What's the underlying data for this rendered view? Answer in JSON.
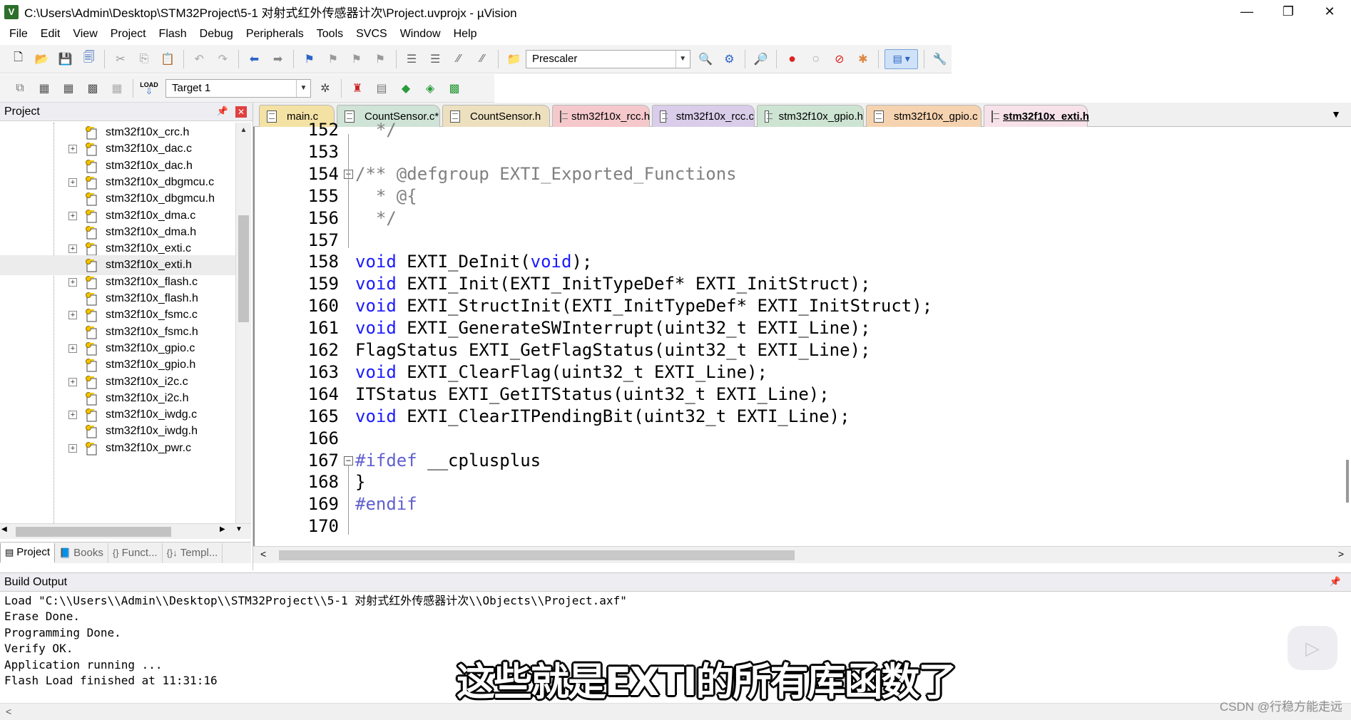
{
  "window": {
    "title": "C:\\Users\\Admin\\Desktop\\STM32Project\\5-1 对射式红外传感器计次\\Project.uvprojx - µVision",
    "minimize": "—",
    "restore": "❐",
    "close": "✕"
  },
  "menu": [
    "File",
    "Edit",
    "View",
    "Project",
    "Flash",
    "Debug",
    "Peripherals",
    "Tools",
    "SVCS",
    "Window",
    "Help"
  ],
  "toolbar1": {
    "find_combo_value": "Prescaler"
  },
  "toolbar2": {
    "target_combo_value": "Target 1",
    "load_label": "LOAD"
  },
  "project_panel": {
    "title": "Project",
    "files": [
      {
        "name": "stm32f10x_crc.h",
        "expandable": false,
        "selected": false
      },
      {
        "name": "stm32f10x_dac.c",
        "expandable": true,
        "selected": false
      },
      {
        "name": "stm32f10x_dac.h",
        "expandable": false,
        "selected": false
      },
      {
        "name": "stm32f10x_dbgmcu.c",
        "expandable": true,
        "selected": false
      },
      {
        "name": "stm32f10x_dbgmcu.h",
        "expandable": false,
        "selected": false
      },
      {
        "name": "stm32f10x_dma.c",
        "expandable": true,
        "selected": false
      },
      {
        "name": "stm32f10x_dma.h",
        "expandable": false,
        "selected": false
      },
      {
        "name": "stm32f10x_exti.c",
        "expandable": true,
        "selected": false
      },
      {
        "name": "stm32f10x_exti.h",
        "expandable": false,
        "selected": true
      },
      {
        "name": "stm32f10x_flash.c",
        "expandable": true,
        "selected": false
      },
      {
        "name": "stm32f10x_flash.h",
        "expandable": false,
        "selected": false
      },
      {
        "name": "stm32f10x_fsmc.c",
        "expandable": true,
        "selected": false
      },
      {
        "name": "stm32f10x_fsmc.h",
        "expandable": false,
        "selected": false
      },
      {
        "name": "stm32f10x_gpio.c",
        "expandable": true,
        "selected": false
      },
      {
        "name": "stm32f10x_gpio.h",
        "expandable": false,
        "selected": false
      },
      {
        "name": "stm32f10x_i2c.c",
        "expandable": true,
        "selected": false
      },
      {
        "name": "stm32f10x_i2c.h",
        "expandable": false,
        "selected": false
      },
      {
        "name": "stm32f10x_iwdg.c",
        "expandable": true,
        "selected": false
      },
      {
        "name": "stm32f10x_iwdg.h",
        "expandable": false,
        "selected": false
      },
      {
        "name": "stm32f10x_pwr.c",
        "expandable": true,
        "selected": false
      }
    ],
    "tabs": [
      {
        "label": "Project",
        "active": true
      },
      {
        "label": "Books",
        "active": false
      },
      {
        "label": "Funct...",
        "active": false
      },
      {
        "label": "Templ...",
        "active": false
      }
    ]
  },
  "editor_tabs": [
    {
      "label": "main.c",
      "color": "#f4e2a4",
      "active": false
    },
    {
      "label": "CountSensor.c*",
      "color": "#cfe3d6",
      "active": false
    },
    {
      "label": "CountSensor.h",
      "color": "#ede0bf",
      "active": false
    },
    {
      "label": "stm32f10x_rcc.h",
      "color": "#f5c8cc",
      "active": false
    },
    {
      "label": "stm32f10x_rcc.c",
      "color": "#d9cdea",
      "active": false
    },
    {
      "label": "stm32f10x_gpio.h",
      "color": "#cde4d3",
      "active": false
    },
    {
      "label": "stm32f10x_gpio.c",
      "color": "#f6d3b0",
      "active": false
    },
    {
      "label": "stm32f10x_exti.h",
      "color": "#f7e2ea",
      "active": true
    }
  ],
  "code": [
    {
      "n": "152",
      "parts": [
        {
          "t": "  */",
          "c": "cm"
        }
      ]
    },
    {
      "n": "153",
      "parts": []
    },
    {
      "n": "154",
      "parts": [
        {
          "t": "/** @defgroup EXTI_Exported_Functions",
          "c": "cm"
        }
      ],
      "fold": "box"
    },
    {
      "n": "155",
      "parts": [
        {
          "t": "  * @{",
          "c": "cm"
        }
      ]
    },
    {
      "n": "156",
      "parts": [
        {
          "t": "  */",
          "c": "cm"
        }
      ]
    },
    {
      "n": "157",
      "parts": []
    },
    {
      "n": "158",
      "parts": [
        {
          "t": "void",
          "c": "kw"
        },
        {
          "t": " EXTI_DeInit(",
          "c": ""
        },
        {
          "t": "void",
          "c": "kw"
        },
        {
          "t": ");",
          "c": ""
        }
      ]
    },
    {
      "n": "159",
      "parts": [
        {
          "t": "void",
          "c": "kw"
        },
        {
          "t": " EXTI_Init(EXTI_InitTypeDef* EXTI_InitStruct);",
          "c": ""
        }
      ]
    },
    {
      "n": "160",
      "parts": [
        {
          "t": "void",
          "c": "kw"
        },
        {
          "t": " EXTI_StructInit(EXTI_InitTypeDef* EXTI_InitStruct);",
          "c": ""
        }
      ]
    },
    {
      "n": "161",
      "parts": [
        {
          "t": "void",
          "c": "kw"
        },
        {
          "t": " EXTI_GenerateSWInterrupt(uint32_t EXTI_Line);",
          "c": ""
        }
      ]
    },
    {
      "n": "162",
      "parts": [
        {
          "t": "FlagStatus EXTI_GetFlagStatus(uint32_t EXTI_Line);",
          "c": ""
        }
      ]
    },
    {
      "n": "163",
      "parts": [
        {
          "t": "void",
          "c": "kw"
        },
        {
          "t": " EXTI_ClearFlag(uint32_t EXTI_Line);",
          "c": ""
        }
      ]
    },
    {
      "n": "164",
      "parts": [
        {
          "t": "ITStatus EXTI_GetITStatus(uint32_t EXTI_Line);",
          "c": ""
        }
      ]
    },
    {
      "n": "165",
      "parts": [
        {
          "t": "void",
          "c": "kw"
        },
        {
          "t": " EXTI_ClearITPendingBit(uint32_t EXTI_Line);",
          "c": ""
        }
      ]
    },
    {
      "n": "166",
      "parts": []
    },
    {
      "n": "167",
      "parts": [
        {
          "t": "#ifdef",
          "c": "pp"
        },
        {
          "t": " __cplusplus",
          "c": ""
        }
      ],
      "fold": "box"
    },
    {
      "n": "168",
      "parts": [
        {
          "t": "}",
          "c": ""
        }
      ]
    },
    {
      "n": "169",
      "parts": [
        {
          "t": "#endif",
          "c": "pp"
        }
      ]
    },
    {
      "n": "170",
      "parts": []
    }
  ],
  "build_output": {
    "title": "Build Output",
    "lines": [
      "Load \"C:\\\\Users\\\\Admin\\\\Desktop\\\\STM32Project\\\\5-1 对射式红外传感器计次\\\\Objects\\\\Project.axf\"",
      "Erase Done.",
      "Programming Done.",
      "Verify OK.",
      "Application running ...",
      "Flash Load finished at 11:31:16"
    ]
  },
  "subtitle": "这些就是EXTI的所有库函数了",
  "watermark": "CSDN @行稳方能走远"
}
